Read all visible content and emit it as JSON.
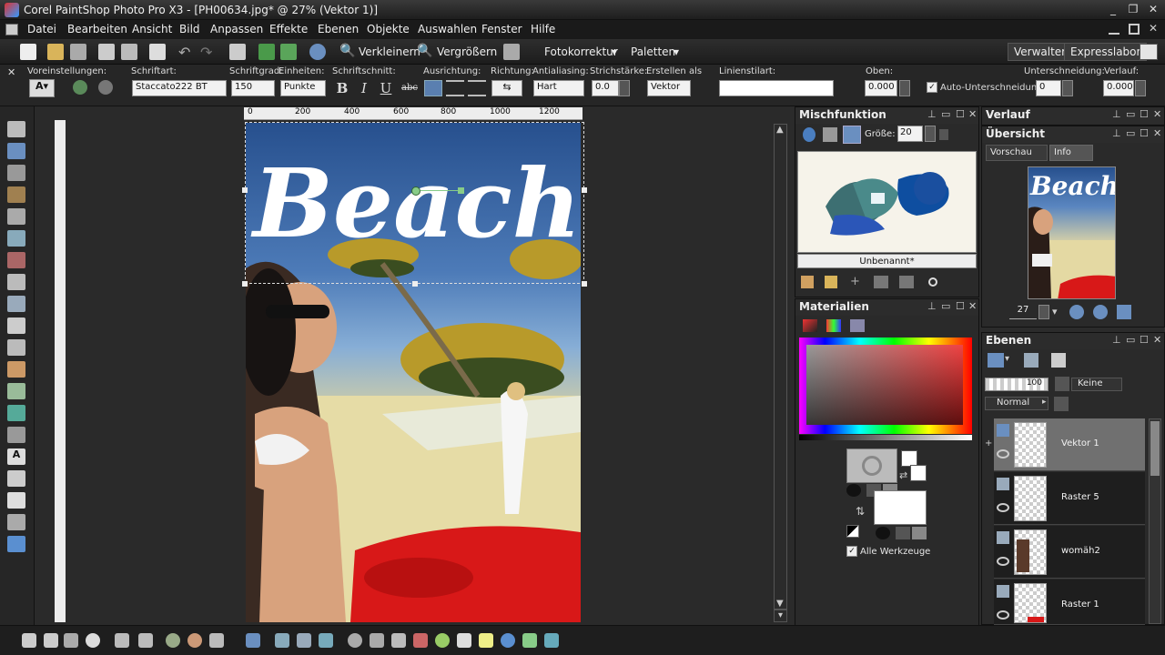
{
  "window": {
    "title": "Corel PaintShop Photo Pro X3 - [PH00634.jpg* @  27% (Vektor 1)]",
    "controls": [
      "_",
      "❐",
      "✕"
    ]
  },
  "menu": [
    "Datei",
    "Bearbeiten",
    "Ansicht",
    "Bild",
    "Anpassen",
    "Effekte",
    "Ebenen",
    "Objekte",
    "Auswahlen",
    "Fenster",
    "Hilfe"
  ],
  "toolbar": {
    "zoom_out": "Verkleinern",
    "zoom_in": "Vergrößern",
    "foto": "Fotokorrektur",
    "paletten": "Paletten",
    "verwalter": "Verwalter",
    "express": "Expresslabor"
  },
  "options": {
    "presets_label": "Voreinstellungen:",
    "font_label": "Schriftart:",
    "font_value": "Staccato222 BT",
    "size_label": "Schriftgrad:",
    "size_value": "150",
    "units_label": "Einheiten:",
    "units_value": "Punkte",
    "style_label": "Schriftschnitt:",
    "bold": "B",
    "italic": "I",
    "underline": "U",
    "strike": "abc",
    "align_label": "Ausrichtung:",
    "direction_label": "Richtung:",
    "aa_label": "Antialiasing:",
    "aa_value": "Hart",
    "stroke_label": "Strichstärke:",
    "stroke_value": "0.0",
    "create_label": "Erstellen als",
    "create_value": "Vektor",
    "linestyle_label": "Linienstilart:",
    "top_label": "Oben:",
    "top_value": "0.000",
    "autokern_label": "Auto-Unterschneidung",
    "kerning_label": "Unterschneidung:",
    "kerning_value": "0",
    "leading_label": "Verlauf:",
    "leading_value": "0.000"
  },
  "ruler": {
    "ticks": [
      "0",
      "200",
      "400",
      "600",
      "800",
      "1000",
      "1200"
    ]
  },
  "canvas": {
    "text": "Beach"
  },
  "mixer": {
    "title": "Mischfunktion",
    "size_label": "Größe:",
    "size_value": "20",
    "caption": "Unbenannt*"
  },
  "materials": {
    "title": "Materialien",
    "all_tools": "Alle Werkzeuge"
  },
  "history": {
    "title": "Verlauf"
  },
  "overview": {
    "title": "Übersicht",
    "tab_preview": "Vorschau",
    "tab_info": "Info",
    "zoom_value": "27"
  },
  "layers": {
    "title": "Ebenen",
    "opacity": "100",
    "mask": "Keine",
    "blend": "Normal",
    "items": [
      {
        "name": "Vektor 1",
        "selected": true
      },
      {
        "name": "Raster 5",
        "selected": false
      },
      {
        "name": "womäh2",
        "selected": false
      },
      {
        "name": "Raster 1",
        "selected": false
      }
    ]
  },
  "colors": {
    "accent": "#5a8fd0",
    "panel": "#2a2a2a",
    "selected_layer": "#707070",
    "sofa": "#d81818"
  }
}
